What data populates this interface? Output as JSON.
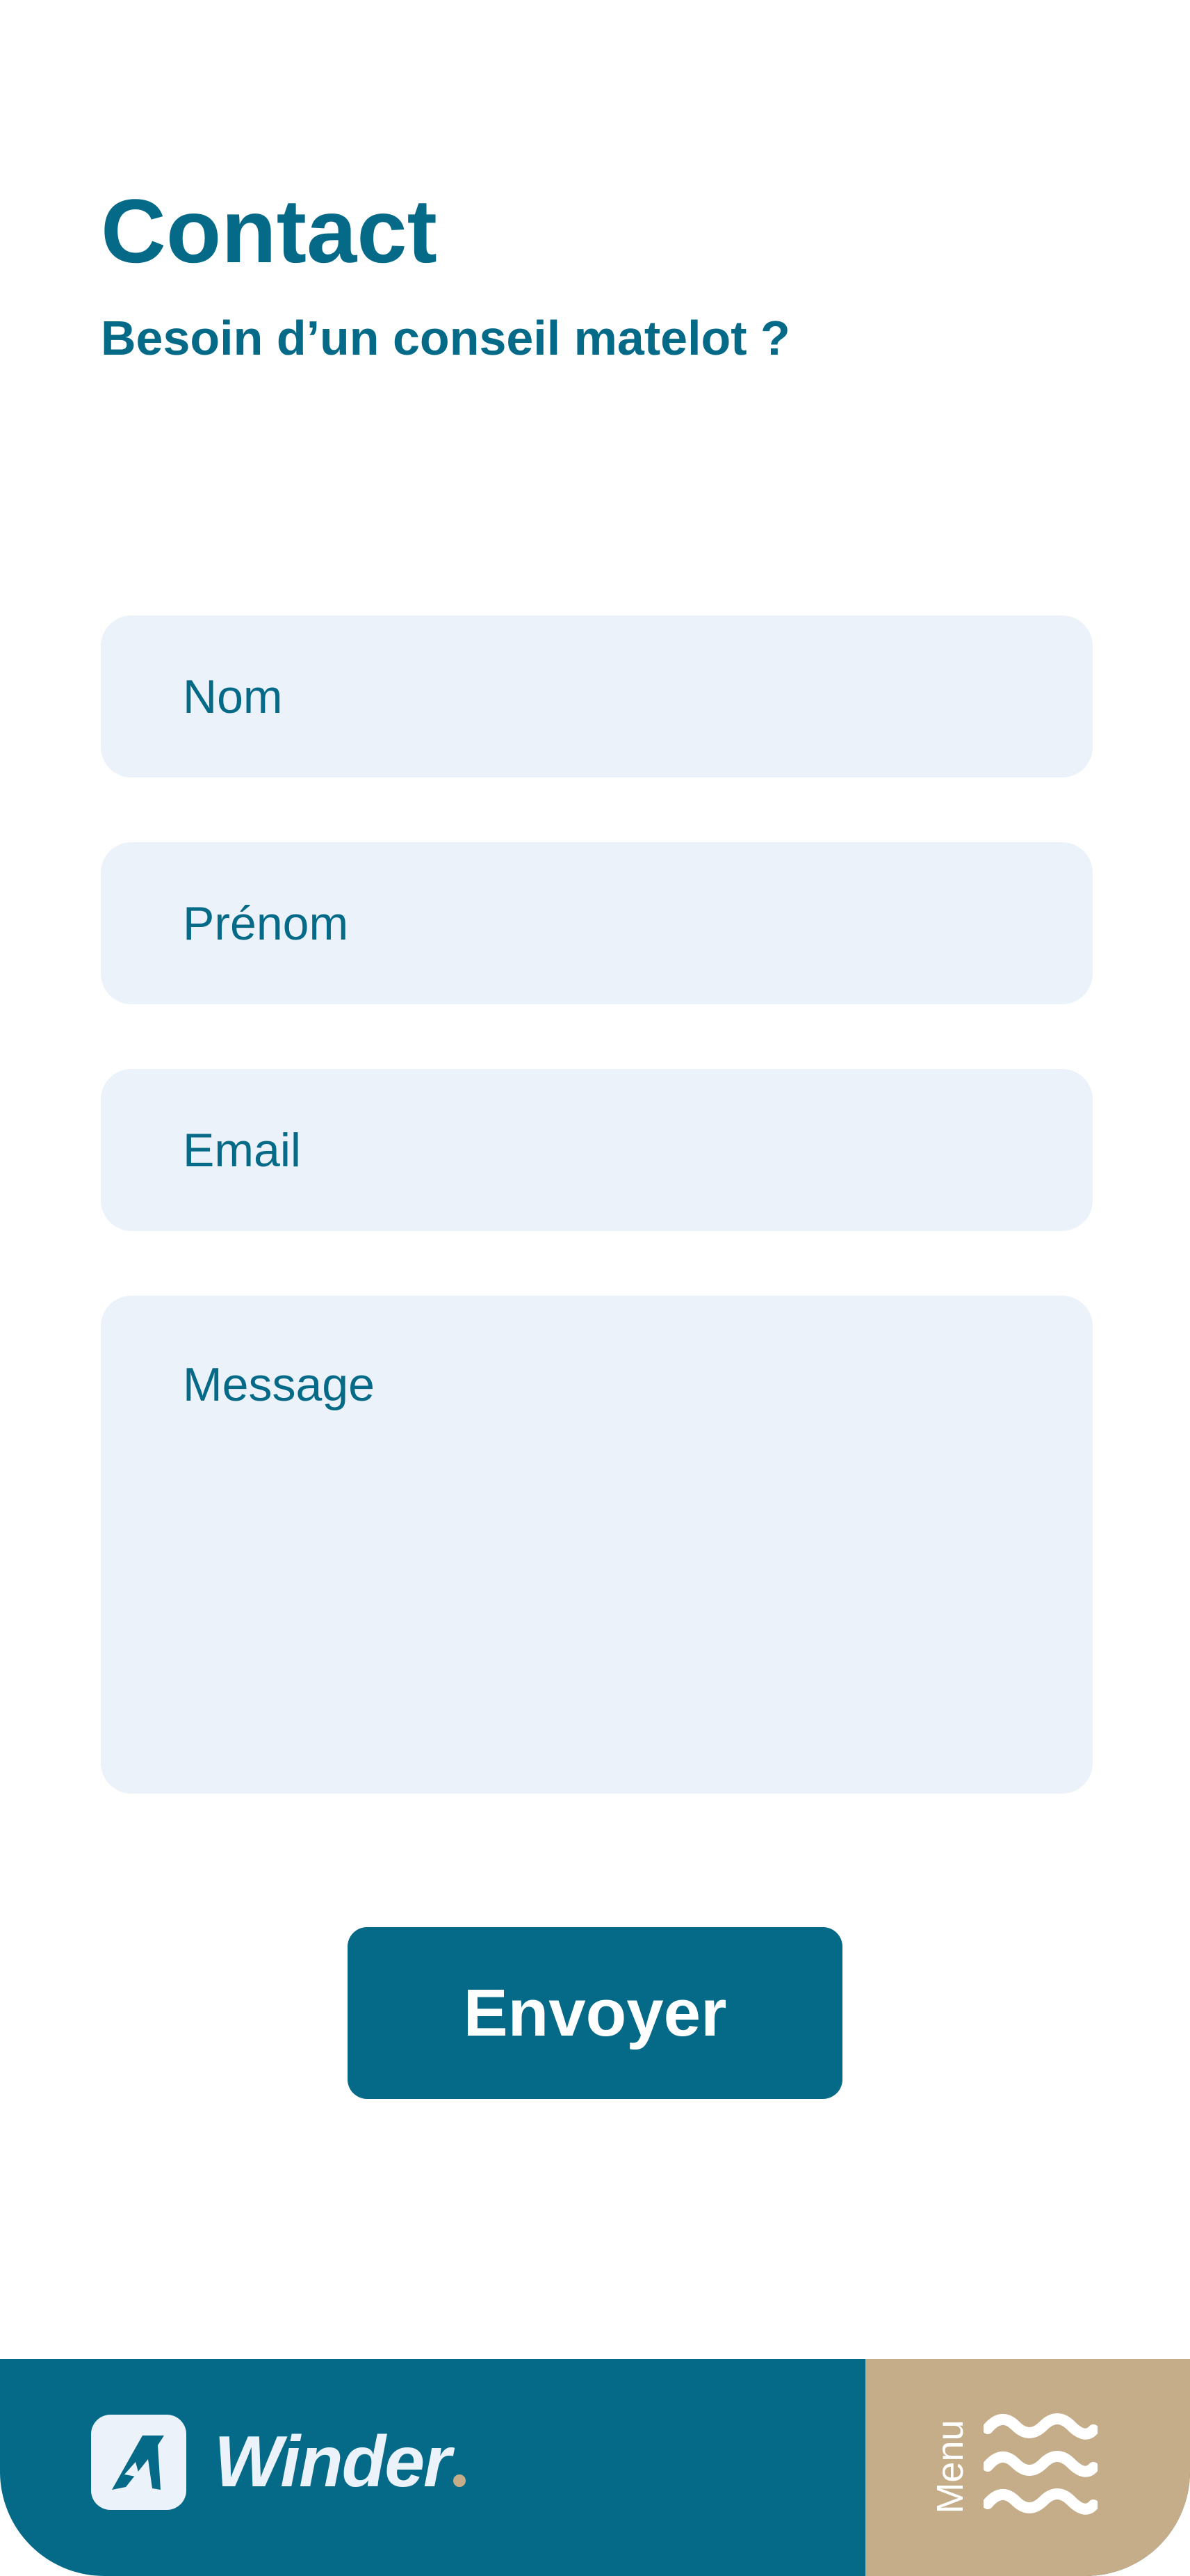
{
  "header": {
    "title": "Contact",
    "subtitle": "Besoin d’un conseil matelot ?"
  },
  "form": {
    "name_placeholder": "Nom",
    "firstname_placeholder": "Prénom",
    "email_placeholder": "Email",
    "message_placeholder": "Message",
    "submit_label": "Envoyer"
  },
  "footer": {
    "brand_name": "Winder",
    "menu_label": "Menu",
    "icons": {
      "logo": "winder-logo-icon",
      "menu": "waves-menu-icon"
    }
  },
  "colors": {
    "primary": "#046a88",
    "field_background": "#ebf2f9",
    "accent": "#c4ad88",
    "background": "#ffffff"
  }
}
